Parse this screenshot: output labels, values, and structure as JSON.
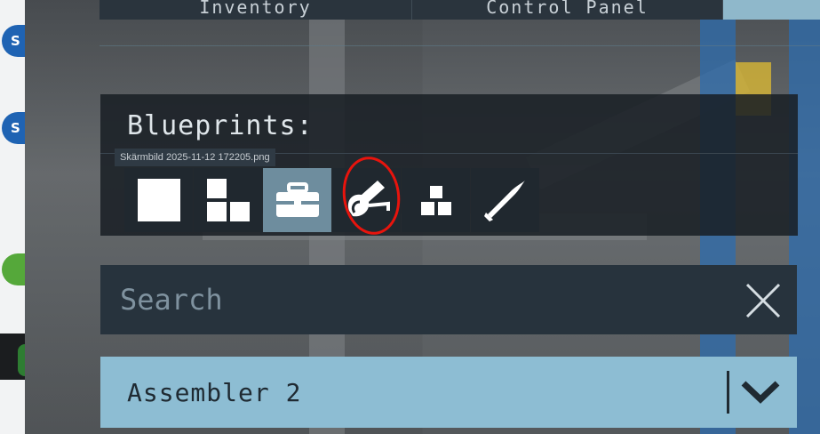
{
  "tabs": [
    {
      "label": "Inventory"
    },
    {
      "label": "Control Panel"
    },
    {
      "label": ""
    }
  ],
  "blueprints": {
    "title": "Blueprints:",
    "tooltip": "Skärmbild 2025-11-12 172205.png",
    "categories": [
      {
        "icon": "large-block-icon",
        "active": false
      },
      {
        "icon": "small-block-icon",
        "active": false
      },
      {
        "icon": "toolbox-icon",
        "active": true
      },
      {
        "icon": "welder-tool-icon",
        "active": false,
        "highlighted": true
      },
      {
        "icon": "components-icon",
        "active": false
      },
      {
        "icon": "ammo-icon",
        "active": false
      }
    ]
  },
  "search": {
    "placeholder": "Search",
    "value": ""
  },
  "dropdown": {
    "selected": "Assembler 2"
  },
  "colors": {
    "panel": "#181e24",
    "active_tab": "#8fb8cb",
    "dropdown": "#8dbdd3",
    "annotation": "#e8140d"
  }
}
